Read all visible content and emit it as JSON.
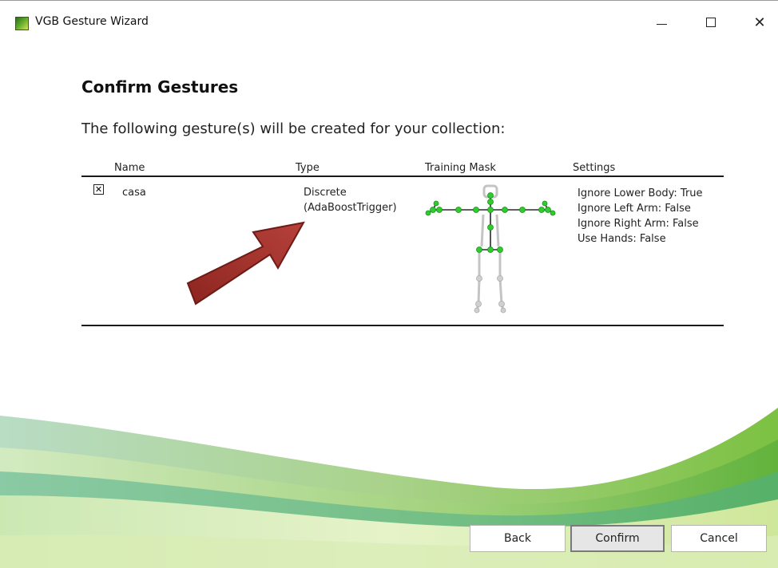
{
  "window": {
    "title": "VGB Gesture Wizard",
    "minimize_glyph": "minimize",
    "maximize_glyph": "maximize",
    "close_glyph": "✕"
  },
  "page": {
    "title": "Confirm Gestures",
    "subtitle": "The following gesture(s) will be created for your collection:"
  },
  "table": {
    "headers": [
      "Name",
      "Type",
      "Training Mask",
      "Settings"
    ],
    "rows": [
      {
        "checked": true,
        "checkbox_glyph": "✕",
        "name": "casa",
        "type_line1": "Discrete",
        "type_line2": "(AdaBoostTrigger)",
        "settings": [
          "Ignore Lower Body: True",
          "Ignore Left Arm: False",
          "Ignore Right Arm: False",
          "Use Hands: False"
        ]
      }
    ]
  },
  "buttons": {
    "back": "Back",
    "confirm": "Confirm",
    "cancel": "Cancel"
  },
  "colors": {
    "active_joint": "#2ecc2e",
    "inactive_joint": "#c8c8c8",
    "arrow": "#a8332c",
    "wave_green": "#8cc63f",
    "wave_teal": "#3fa58a"
  },
  "icons": [
    "app-icon",
    "checkbox-icon",
    "arrow-icon",
    "skeleton-icon"
  ]
}
